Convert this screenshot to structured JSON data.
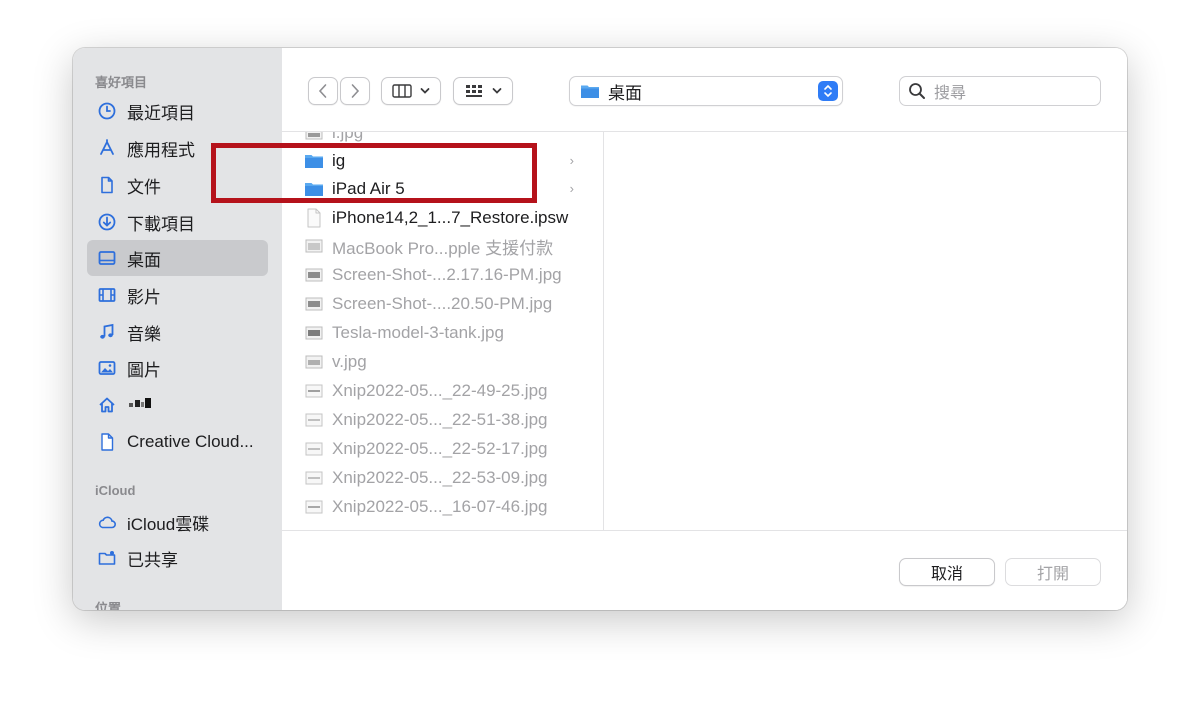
{
  "colors": {
    "accent": "#2f7cf6",
    "highlight": "#b5121b",
    "sidebar_bg": "#e3e4e6",
    "selected_bg": "#c9cacd"
  },
  "sidebar": {
    "favorites_title": "喜好項目",
    "items": [
      {
        "label": "最近項目",
        "icon": "clock-icon"
      },
      {
        "label": "應用程式",
        "icon": "applications-icon"
      },
      {
        "label": "文件",
        "icon": "document-icon"
      },
      {
        "label": "下載項目",
        "icon": "download-icon"
      },
      {
        "label": "桌面",
        "icon": "desktop-icon",
        "selected": true
      },
      {
        "label": "影片",
        "icon": "film-icon"
      },
      {
        "label": "音樂",
        "icon": "music-icon"
      },
      {
        "label": "圖片",
        "icon": "photo-icon"
      },
      {
        "label": "",
        "icon": "home-icon"
      },
      {
        "label": "Creative Cloud...",
        "icon": "file-icon"
      }
    ],
    "icloud_title": "iCloud",
    "icloud_items": [
      {
        "label": "iCloud雲碟",
        "icon": "cloud-icon"
      },
      {
        "label": "已共享",
        "icon": "shared-folder-icon"
      }
    ],
    "locations_title": "位置"
  },
  "toolbar": {
    "back_icon": "chevron-left-icon",
    "forward_icon": "chevron-right-icon",
    "view_columns_icon": "columns-icon",
    "group_icon": "grid-icon",
    "location": "桌面",
    "search_placeholder": "搜尋"
  },
  "files": [
    {
      "name": "i.jpg",
      "type": "image",
      "dim": true
    },
    {
      "name": "ig",
      "type": "folder",
      "dim": false,
      "has_children": true
    },
    {
      "name": "iPad Air 5",
      "type": "folder",
      "dim": false,
      "has_children": true
    },
    {
      "name": "iPhone14,2_1...7_Restore.ipsw",
      "type": "file",
      "dim": false
    },
    {
      "name": "MacBook Pro...pple 支援付款",
      "type": "image",
      "dim": true
    },
    {
      "name": "Screen-Shot-...2.17.16-PM.jpg",
      "type": "image",
      "dim": true
    },
    {
      "name": "Screen-Shot-....20.50-PM.jpg",
      "type": "image",
      "dim": true
    },
    {
      "name": "Tesla-model-3-tank.jpg",
      "type": "image",
      "dim": true
    },
    {
      "name": "v.jpg",
      "type": "image",
      "dim": true
    },
    {
      "name": "Xnip2022-05..._22-49-25.jpg",
      "type": "image",
      "dim": true
    },
    {
      "name": "Xnip2022-05..._22-51-38.jpg",
      "type": "image",
      "dim": true
    },
    {
      "name": "Xnip2022-05..._22-52-17.jpg",
      "type": "image",
      "dim": true
    },
    {
      "name": "Xnip2022-05..._22-53-09.jpg",
      "type": "image",
      "dim": true
    },
    {
      "name": "Xnip2022-05..._16-07-46.jpg",
      "type": "image",
      "dim": true
    }
  ],
  "buttons": {
    "cancel": "取消",
    "open": "打開"
  }
}
